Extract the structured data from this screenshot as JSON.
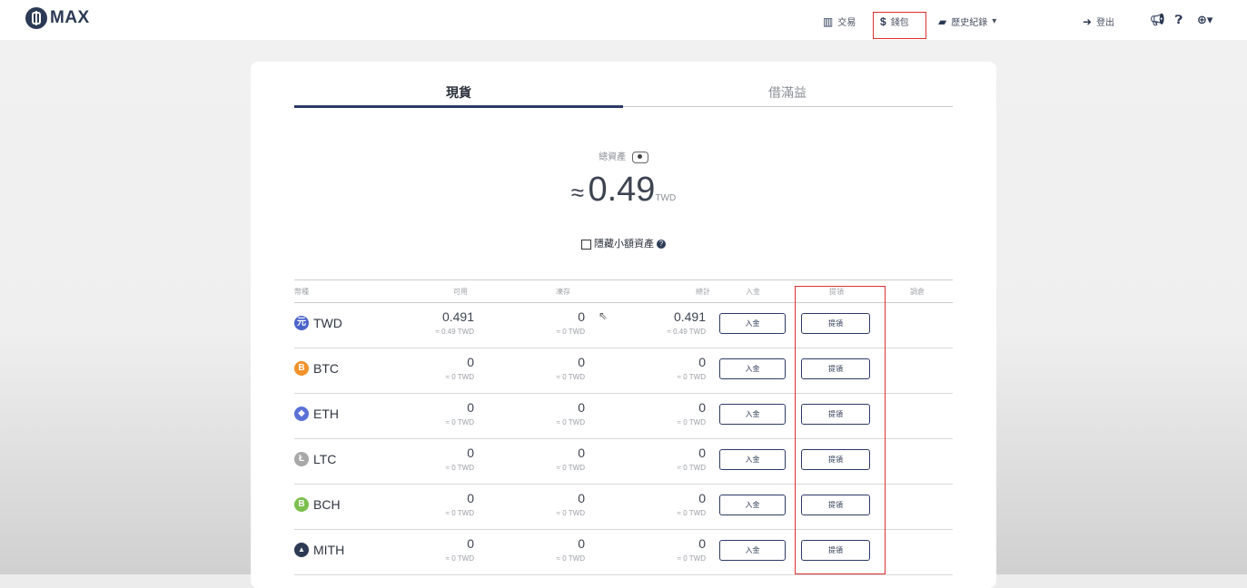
{
  "brand": {
    "name": "MAX"
  },
  "nav": {
    "trade": {
      "icon": "bar-chart-icon",
      "label": "交易"
    },
    "wallet": {
      "icon": "dollar-icon",
      "label": "錢包"
    },
    "history": {
      "icon": "book-icon",
      "label": "歷史紀錄",
      "caret": "▾"
    },
    "logout": {
      "icon": "sign-out-icon",
      "label": "登出"
    }
  },
  "tabs": [
    {
      "label": "現貨",
      "active": true
    },
    {
      "label": "借滿益",
      "active": false
    }
  ],
  "summary": {
    "label": "總資產",
    "approx": "≈",
    "value": "0.49",
    "unit": "TWD"
  },
  "hide_small": {
    "label": "隱藏小額資產"
  },
  "table": {
    "headers": [
      "幣種",
      "可用",
      "凍存",
      "總計",
      "入金",
      "提領",
      "調倉"
    ],
    "rows": [
      {
        "coin": "TWD",
        "icon_color": "#4a63c9",
        "icon_glyph": "元",
        "available": "0.491",
        "available_twd": "≈ 0.49 TWD",
        "locked": "0",
        "locked_twd": "≈ 0 TWD",
        "total": "0.491",
        "total_twd": "≈ 0.49 TWD",
        "deposit": "入金",
        "withdraw": "提領"
      },
      {
        "coin": "BTC",
        "icon_color": "#f2922b",
        "icon_glyph": "B",
        "available": "0",
        "available_twd": "≈ 0 TWD",
        "locked": "0",
        "locked_twd": "≈ 0 TWD",
        "total": "0",
        "total_twd": "≈ 0 TWD",
        "deposit": "入金",
        "withdraw": "提領"
      },
      {
        "coin": "ETH",
        "icon_color": "#5b72d6",
        "icon_glyph": "◆",
        "available": "0",
        "available_twd": "≈ 0 TWD",
        "locked": "0",
        "locked_twd": "≈ 0 TWD",
        "total": "0",
        "total_twd": "≈ 0 TWD",
        "deposit": "入金",
        "withdraw": "提領"
      },
      {
        "coin": "LTC",
        "icon_color": "#a8a8a8",
        "icon_glyph": "Ł",
        "available": "0",
        "available_twd": "≈ 0 TWD",
        "locked": "0",
        "locked_twd": "≈ 0 TWD",
        "total": "0",
        "total_twd": "≈ 0 TWD",
        "deposit": "入金",
        "withdraw": "提領"
      },
      {
        "coin": "BCH",
        "icon_color": "#7cbf4f",
        "icon_glyph": "B",
        "available": "0",
        "available_twd": "≈ 0 TWD",
        "locked": "0",
        "locked_twd": "≈ 0 TWD",
        "total": "0",
        "total_twd": "≈ 0 TWD",
        "deposit": "入金",
        "withdraw": "提領"
      },
      {
        "coin": "MITH",
        "icon_color": "#2c3a55",
        "icon_glyph": "▲",
        "available": "0",
        "available_twd": "≈ 0 TWD",
        "locked": "0",
        "locked_twd": "≈ 0 TWD",
        "total": "0",
        "total_twd": "≈ 0 TWD",
        "deposit": "入金",
        "withdraw": "提領"
      }
    ]
  },
  "colors": {
    "accent": "#2c3a67",
    "highlight": "#e0302e"
  }
}
